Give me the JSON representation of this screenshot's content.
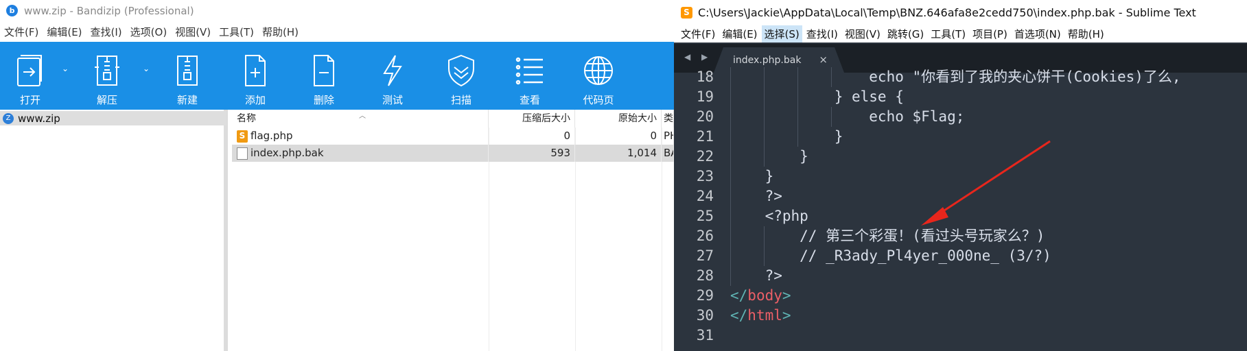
{
  "bandizip": {
    "title": "www.zip - Bandizip (Professional)",
    "menu": [
      "文件(F)",
      "编辑(E)",
      "查找(I)",
      "选项(O)",
      "视图(V)",
      "工具(T)",
      "帮助(H)"
    ],
    "toolbar": {
      "open": "打开",
      "extract": "解压",
      "new": "新建",
      "add": "添加",
      "delete": "删除",
      "test": "测试",
      "scan": "扫描",
      "view": "查看",
      "codepage": "代码页"
    },
    "tree": {
      "root": "www.zip"
    },
    "list": {
      "headers": {
        "name": "名称",
        "compressed": "压缩后大小",
        "original": "原始大小",
        "type": "类型"
      },
      "rows": [
        {
          "name": "flag.php",
          "compressed": "0",
          "original": "0",
          "type": "PHP",
          "icon": "php-file-icon"
        },
        {
          "name": "index.php.bak",
          "compressed": "593",
          "original": "1,014",
          "type": "BAK",
          "icon": "bak-file-icon"
        }
      ]
    }
  },
  "sublime": {
    "title": "C:\\Users\\Jackie\\AppData\\Local\\Temp\\BNZ.646afa8e2cedd750\\index.php.bak - Sublime Text",
    "menu": [
      "文件(F)",
      "编辑(E)",
      "选择(S)",
      "查找(I)",
      "视图(V)",
      "跳转(G)",
      "工具(T)",
      "项目(P)",
      "首选项(N)",
      "帮助(H)"
    ],
    "active_menu": "选择(S)",
    "tab": {
      "name": "index.php.bak",
      "close": "×"
    },
    "nav_arrows": "◀ ▶",
    "lines": [
      {
        "n": "18",
        "text": "                echo \"你看到了我的夹心饼干(Cookies)了么,",
        "indent": 4
      },
      {
        "n": "19",
        "text": "            } else {",
        "indent": 3
      },
      {
        "n": "20",
        "text": "                echo $Flag;",
        "indent": 4
      },
      {
        "n": "21",
        "text": "            }",
        "indent": 3
      },
      {
        "n": "22",
        "text": "        }",
        "indent": 2
      },
      {
        "n": "23",
        "text": "    }",
        "indent": 1
      },
      {
        "n": "24",
        "text": "    ?>",
        "indent": 1
      },
      {
        "n": "25",
        "text": "    <?php",
        "indent": 1
      },
      {
        "n": "26",
        "text": "        // 第三个彩蛋！(看过头号玩家么？)",
        "indent": 2
      },
      {
        "n": "27",
        "text": "        // _R3ady_Pl4yer_000ne_ (3/?)",
        "indent": 2
      },
      {
        "n": "28",
        "text": "    ?>",
        "indent": 1
      },
      {
        "n": "29",
        "text": "</body>",
        "indent": 0,
        "tag": "body"
      },
      {
        "n": "30",
        "text": "</html>",
        "indent": 0,
        "tag": "html"
      },
      {
        "n": "31",
        "text": "",
        "indent": 0
      }
    ]
  },
  "colors": {
    "toolbar_bg": "#1a8fe6",
    "editor_bg": "#2c343e",
    "tag_red": "#ec5f67",
    "tag_punct": "#5fb3b3",
    "annotation_arrow": "#e8261c"
  }
}
